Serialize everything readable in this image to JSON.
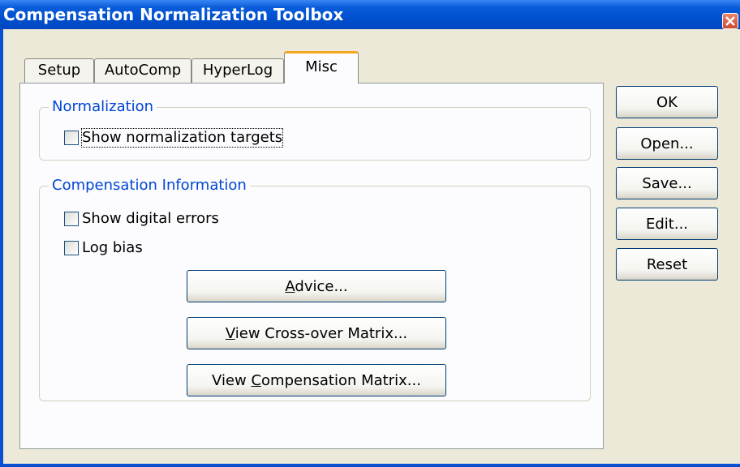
{
  "window": {
    "title": "Compensation Normalization Toolbox"
  },
  "tabs": [
    {
      "label": "Setup"
    },
    {
      "label": "AutoComp"
    },
    {
      "label": "HyperLog"
    },
    {
      "label": "Misc"
    }
  ],
  "active_tab": "Misc",
  "normalization": {
    "group_label": "Normalization",
    "show_targets": {
      "label": "Show normalization targets",
      "checked": false
    }
  },
  "compensation_info": {
    "group_label": "Compensation Information",
    "show_digital_errors": {
      "label": "Show digital errors",
      "checked": false
    },
    "log_bias": {
      "label": "Log bias",
      "checked": false
    },
    "advice_button": {
      "pre": "",
      "key": "A",
      "post": "dvice..."
    },
    "crossover_button": {
      "pre": "",
      "key": "V",
      "post": "iew Cross-over Matrix..."
    },
    "compensation_button": {
      "pre": "View ",
      "key": "C",
      "post": "ompensation Matrix..."
    }
  },
  "side_buttons": {
    "ok": "OK",
    "open": "Open...",
    "save": "Save...",
    "edit": "Edit...",
    "reset": "Reset"
  },
  "colors": {
    "titlebar": "#0a5cd9",
    "group_label": "#0046d5",
    "active_tab_accent": "#f5a623",
    "dialog_bg": "#ece9d8"
  }
}
